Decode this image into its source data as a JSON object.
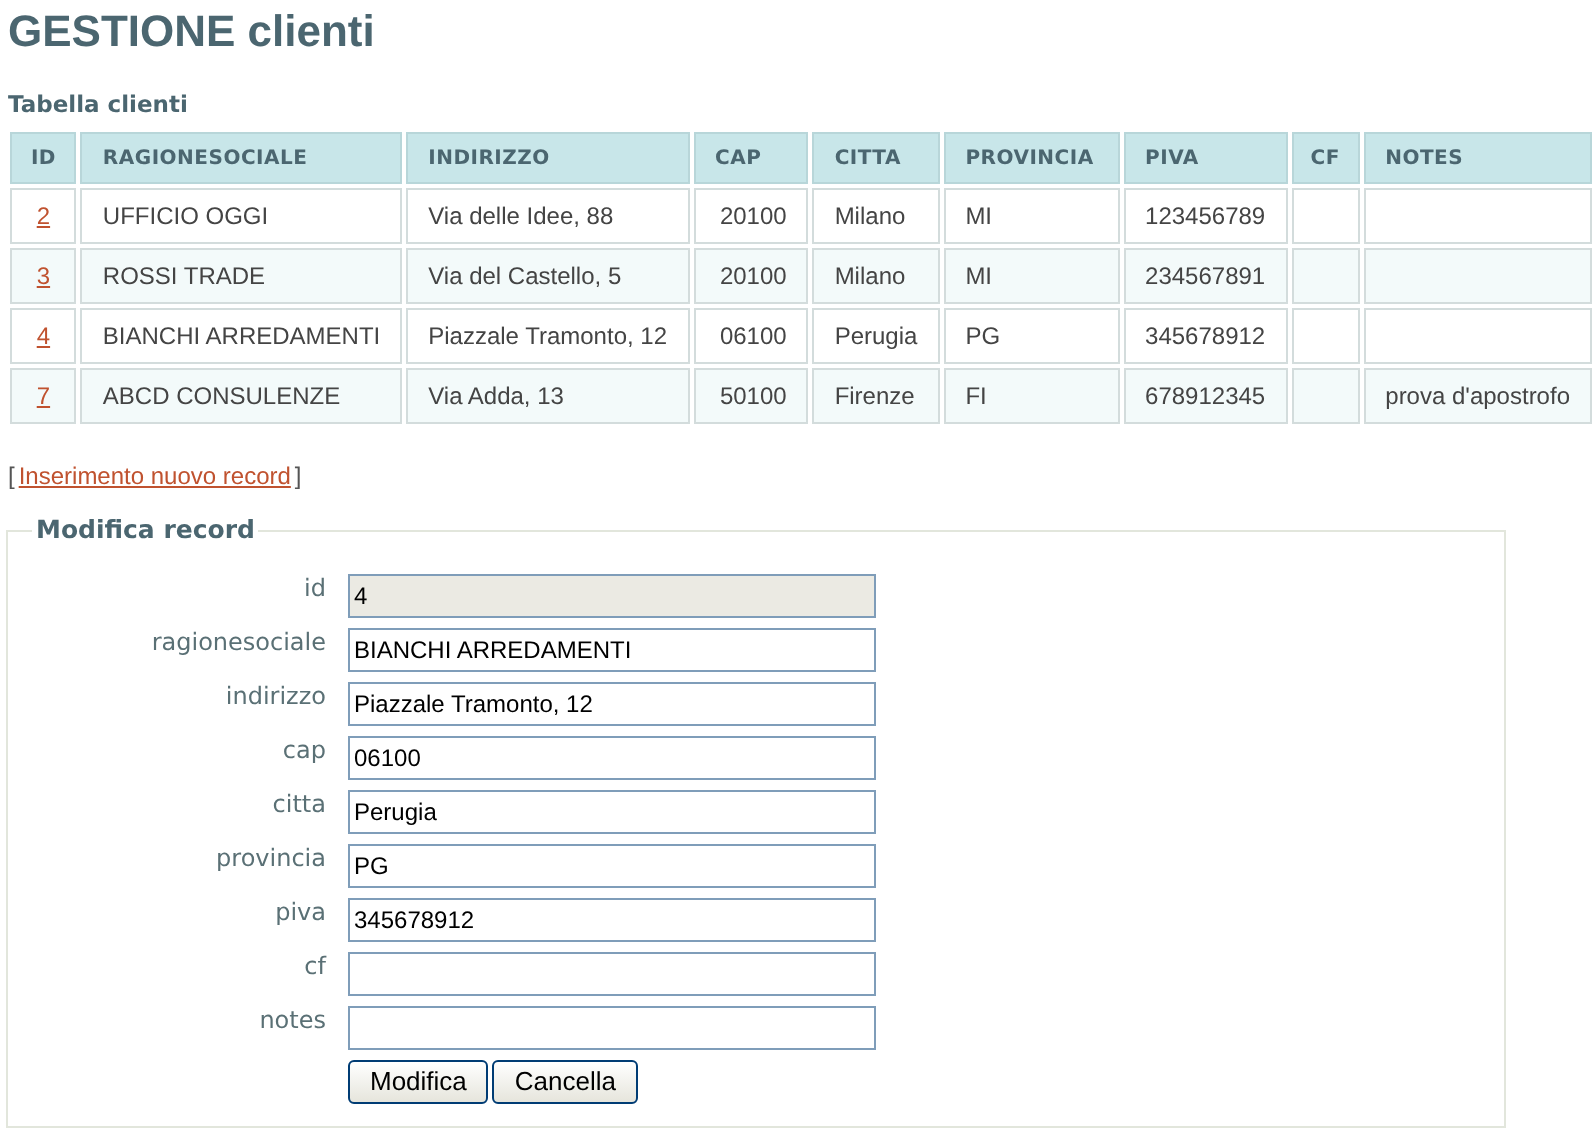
{
  "title": "GESTIONE clienti",
  "table": {
    "caption": "Tabella clienti",
    "columns": [
      "ID",
      "RAGIONESOCIALE",
      "INDIRIZZO",
      "CAP",
      "CITTA",
      "PROVINCIA",
      "PIVA",
      "CF",
      "NOTES"
    ],
    "rows": [
      {
        "cells": [
          "2",
          "UFFICIO OGGI",
          "Via delle Idee, 88",
          "20100",
          "Milano",
          "MI",
          "123456789",
          "",
          ""
        ]
      },
      {
        "cells": [
          "3",
          "ROSSI TRADE",
          "Via del Castello, 5",
          "20100",
          "Milano",
          "MI",
          "234567891",
          "",
          ""
        ]
      },
      {
        "cells": [
          "4",
          "BIANCHI ARREDAMENTI",
          "Piazzale Tramonto, 12",
          "06100",
          "Perugia",
          "PG",
          "345678912",
          "",
          ""
        ]
      },
      {
        "cells": [
          "7",
          "ABCD CONSULENZE",
          "Via Adda, 13",
          "50100",
          "Firenze",
          "FI",
          "678912345",
          "",
          "prova d'apostrofo"
        ]
      }
    ]
  },
  "new_record": {
    "open_bracket": "[",
    "link": "Inserimento nuovo record",
    "close_bracket": "]"
  },
  "form": {
    "legend": "Modifica record",
    "fields": [
      {
        "label": "id",
        "value": "4",
        "disabled": true
      },
      {
        "label": "ragionesociale",
        "value": "BIANCHI ARREDAMENTI",
        "disabled": false
      },
      {
        "label": "indirizzo",
        "value": "Piazzale Tramonto, 12",
        "disabled": false
      },
      {
        "label": "cap",
        "value": "06100",
        "disabled": false
      },
      {
        "label": "citta",
        "value": "Perugia",
        "disabled": false
      },
      {
        "label": "provincia",
        "value": "PG",
        "disabled": false
      },
      {
        "label": "piva",
        "value": "345678912",
        "disabled": false
      },
      {
        "label": "cf",
        "disabled": false
      },
      {
        "label": "notes",
        "disabled": false
      }
    ],
    "buttons": [
      "Modifica",
      "Cancella"
    ]
  }
}
